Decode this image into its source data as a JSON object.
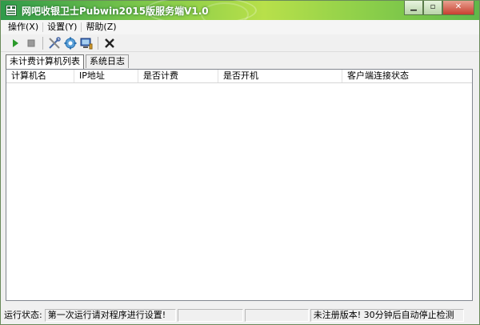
{
  "window": {
    "title": "网吧收银卫士Pubwin2015版服务端V1.0",
    "min_glyph": "▁",
    "max_glyph": "▫",
    "close_glyph": "✕"
  },
  "menu": [
    {
      "label": "操作(X)"
    },
    {
      "label": "设置(Y)"
    },
    {
      "label": "帮助(Z)"
    }
  ],
  "toolbar": {
    "icons": [
      "play-icon",
      "stop-icon",
      "tools-icon",
      "settings-icon",
      "computer-icon",
      "close-icon"
    ],
    "colors": {
      "play": "#2a9a2a",
      "stop": "#9a9a9a",
      "close": "#222222"
    }
  },
  "tabs": [
    {
      "label": "未计费计算机列表"
    },
    {
      "label": "系统日志"
    }
  ],
  "list": {
    "columns": [
      {
        "label": "计算机名"
      },
      {
        "label": "IP地址"
      },
      {
        "label": "是否计费"
      },
      {
        "label": "是否开机"
      },
      {
        "label": "客户端连接状态"
      }
    ],
    "rows": []
  },
  "status": {
    "label": "运行状态:",
    "message": "第一次运行请对程序进行设置!",
    "empty1": "",
    "empty2": "",
    "notice": "未注册版本! 30分钟后自动停止检测"
  }
}
